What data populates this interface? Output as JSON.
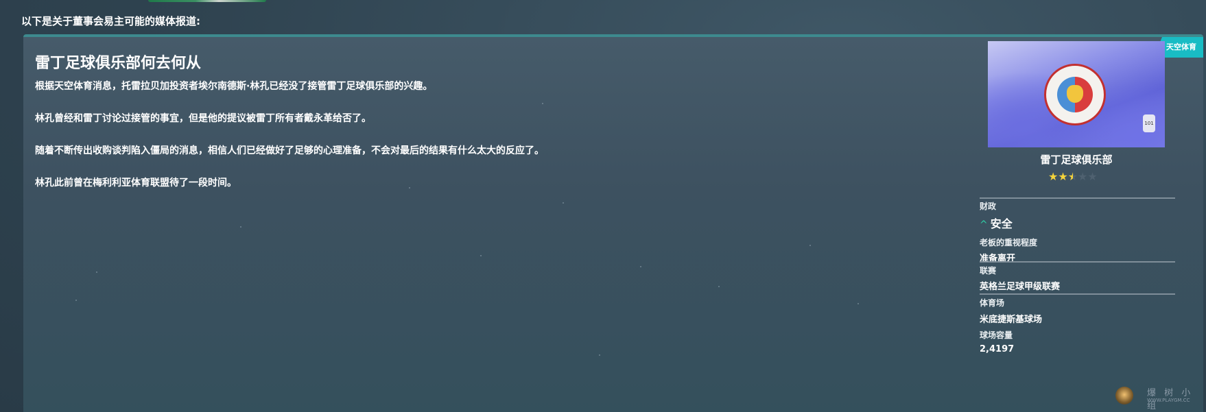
{
  "intro_text": "以下是关于董事会易主可能的媒体报道:",
  "source_badge": "天空体育",
  "headline": "雷丁足球俱乐部何去何从",
  "paragraphs": [
    "根据天空体育消息，托雷拉贝加投资者埃尔南德斯·林孔已经没了接管雷丁足球俱乐部的兴趣。",
    "林孔曾经和雷丁讨论过接管的事宜，但是他的提议被雷丁所有者戴永革给否了。",
    "随着不断传出收购谈判陷入僵局的消息，相信人们已经做好了足够的心理准备，不会对最后的结果有什么太大的反应了。",
    "林孔此前曾在梅利利亚体育联盟待了一段时间。"
  ],
  "club": {
    "name": "雷丁足球俱乐部",
    "rating": 2.5,
    "rating_max": 5,
    "seat_number": "101",
    "finance_label": "财政",
    "finance_value": "安全",
    "finance_icon": "chevron-up-icon",
    "owner_attention_label": "老板的重视程度",
    "owner_attention_value": "准备离开",
    "league_label": "联赛",
    "league_value": "英格兰足球甲级联赛",
    "stadium_label": "体育场",
    "stadium_value": "米底捷斯基球场",
    "capacity_label": "球场容量",
    "capacity_value": "2,4197"
  },
  "watermark": {
    "title": "爆 树 小 组",
    "url": "WWW.PLAYGM.CC"
  },
  "colors": {
    "badge": "#19bcc4",
    "accent_up": "#2fd0a5",
    "star_on": "#f5d43b",
    "star_off": "#4f6170"
  }
}
